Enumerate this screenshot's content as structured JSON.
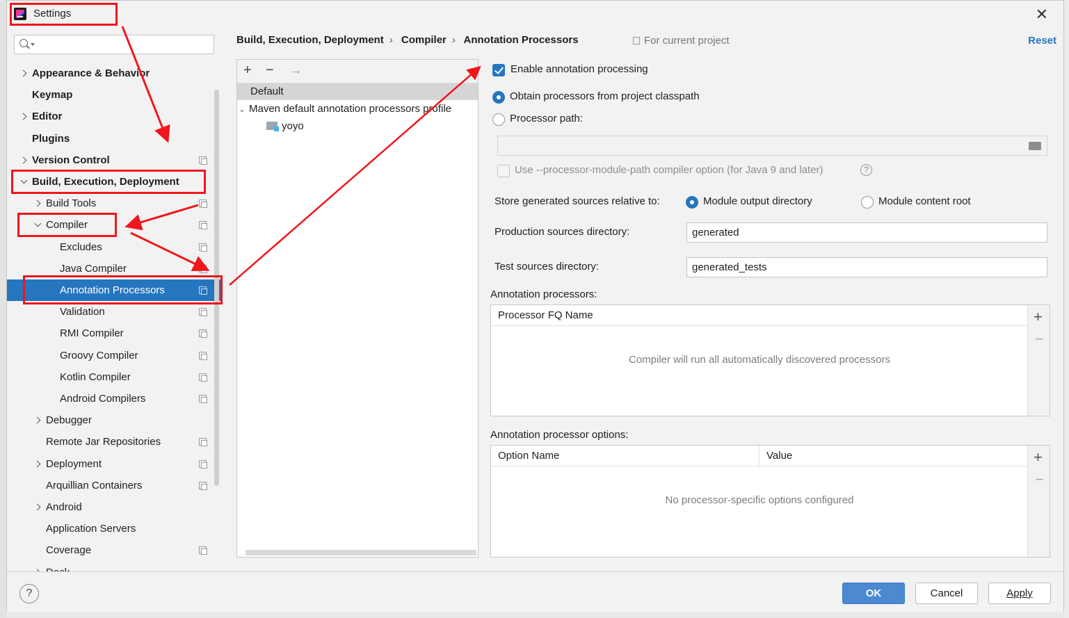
{
  "window": {
    "title": "Settings"
  },
  "sidebar": {
    "search_placeholder": "",
    "items": [
      {
        "label": "Appearance & Behavior",
        "indent": 0,
        "bold": true,
        "arrow": "right",
        "proj": false
      },
      {
        "label": "Keymap",
        "indent": 0,
        "bold": true,
        "arrow": "none",
        "proj": false
      },
      {
        "label": "Editor",
        "indent": 0,
        "bold": true,
        "arrow": "right",
        "proj": false
      },
      {
        "label": "Plugins",
        "indent": 0,
        "bold": true,
        "arrow": "none",
        "proj": false
      },
      {
        "label": "Version Control",
        "indent": 0,
        "bold": true,
        "arrow": "right",
        "proj": true
      },
      {
        "label": "Build, Execution, Deployment",
        "indent": 0,
        "bold": true,
        "arrow": "down",
        "proj": false
      },
      {
        "label": "Build Tools",
        "indent": 1,
        "bold": false,
        "arrow": "right",
        "proj": true
      },
      {
        "label": "Compiler",
        "indent": 1,
        "bold": false,
        "arrow": "down",
        "proj": true
      },
      {
        "label": "Excludes",
        "indent": 2,
        "bold": false,
        "arrow": "none",
        "proj": true
      },
      {
        "label": "Java Compiler",
        "indent": 2,
        "bold": false,
        "arrow": "none",
        "proj": true
      },
      {
        "label": "Annotation Processors",
        "indent": 2,
        "bold": false,
        "arrow": "none",
        "proj": true,
        "selected": true
      },
      {
        "label": "Validation",
        "indent": 2,
        "bold": false,
        "arrow": "none",
        "proj": true
      },
      {
        "label": "RMI Compiler",
        "indent": 2,
        "bold": false,
        "arrow": "none",
        "proj": true
      },
      {
        "label": "Groovy Compiler",
        "indent": 2,
        "bold": false,
        "arrow": "none",
        "proj": true
      },
      {
        "label": "Kotlin Compiler",
        "indent": 2,
        "bold": false,
        "arrow": "none",
        "proj": true
      },
      {
        "label": "Android Compilers",
        "indent": 2,
        "bold": false,
        "arrow": "none",
        "proj": true
      },
      {
        "label": "Debugger",
        "indent": 1,
        "bold": false,
        "arrow": "right",
        "proj": false
      },
      {
        "label": "Remote Jar Repositories",
        "indent": 1,
        "bold": false,
        "arrow": "none",
        "proj": true
      },
      {
        "label": "Deployment",
        "indent": 1,
        "bold": false,
        "arrow": "right",
        "proj": true
      },
      {
        "label": "Arquillian Containers",
        "indent": 1,
        "bold": false,
        "arrow": "none",
        "proj": true
      },
      {
        "label": "Android",
        "indent": 1,
        "bold": false,
        "arrow": "right",
        "proj": false
      },
      {
        "label": "Application Servers",
        "indent": 1,
        "bold": false,
        "arrow": "none",
        "proj": false
      },
      {
        "label": "Coverage",
        "indent": 1,
        "bold": false,
        "arrow": "none",
        "proj": true
      },
      {
        "label": "Dock",
        "indent": 1,
        "bold": false,
        "arrow": "right",
        "proj": false
      }
    ]
  },
  "breadcrumb": [
    "Build, Execution, Deployment",
    "Compiler",
    "Annotation Processors"
  ],
  "for_current_project": "For current project",
  "reset_label": "Reset",
  "profiles": {
    "toolbar": [
      "+",
      "−",
      "→"
    ],
    "items": [
      {
        "label": "Default"
      },
      {
        "label": "Maven default annotation processors profile"
      },
      {
        "label": "yoyo"
      }
    ]
  },
  "options": {
    "enable_label": "Enable annotation processing",
    "enable_checked": true,
    "obtain_label": "Obtain processors from project classpath",
    "processor_path_label": "Processor path:",
    "processor_path_value": "",
    "module_path_label": "Use --processor-module-path compiler option (for Java 9 and later)",
    "store_label": "Store generated sources relative to:",
    "store_module_output": "Module output directory",
    "store_content_root": "Module content root",
    "production_label": "Production sources directory:",
    "production_value": "generated",
    "test_label": "Test sources directory:",
    "test_value": "generated_tests"
  },
  "processors_table": {
    "title": "Annotation processors:",
    "column": "Processor FQ Name",
    "empty": "Compiler will run all automatically discovered processors"
  },
  "options_table": {
    "title": "Annotation processor options:",
    "columns": [
      "Option Name",
      "Value"
    ],
    "empty": "No processor-specific options configured"
  },
  "footer": {
    "help": "?",
    "ok": "OK",
    "cancel": "Cancel",
    "apply": "Apply"
  },
  "colors": {
    "accent": "#2675bf",
    "annotation": "#f0161b"
  }
}
